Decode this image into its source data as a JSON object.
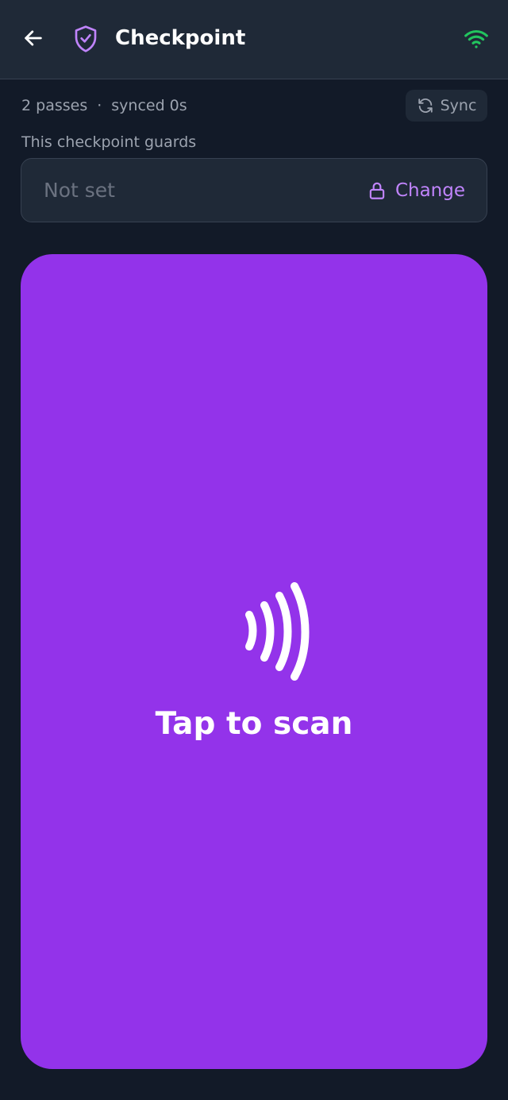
{
  "header": {
    "title": "Checkpoint",
    "back_icon": "arrow-left-icon",
    "shield_icon": "shield-check-icon",
    "wifi_icon": "wifi-icon"
  },
  "status": {
    "passes": "2 passes",
    "separator": "·",
    "synced": "synced 0s",
    "sync_label": "Sync"
  },
  "guard": {
    "label": "This checkpoint guards",
    "value": "Not set",
    "change_label": "Change"
  },
  "scan": {
    "label": "Tap to scan",
    "icon": "nfc-contactless-icon"
  },
  "colors": {
    "background": "#121a28",
    "header": "#1f2937",
    "accent": "#9333ea",
    "accent_light": "#c084fc",
    "online": "#22c55e",
    "muted_text": "#9ca3af"
  }
}
